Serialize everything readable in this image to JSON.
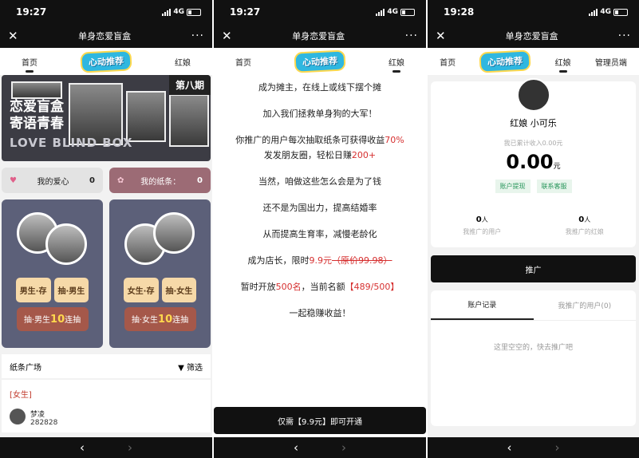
{
  "status": {
    "time1": "19:27",
    "time2": "19:27",
    "time3": "19:28",
    "network": "4G"
  },
  "app_title": "单身恋爱盲盒",
  "nav": {
    "home": "首页",
    "matchmaker": "红娘",
    "admin": "管理员端",
    "logo": "心动推荐"
  },
  "page1": {
    "banner_line1": "恋爱盲盒",
    "banner_line2": "寄语青春",
    "banner_en": "LOVE BLIND BOX",
    "issue": "第八期",
    "love_label": "我的爱心",
    "love_count": "0",
    "note_label": "我的纸条：",
    "note_count": "0",
    "male_store": "男生·存",
    "male_draw": "抽·男生",
    "male_big_pre": "抽·男生",
    "male_big_num": "10",
    "male_big_post": "连抽",
    "female_store": "女生·存",
    "female_draw": "抽·女生",
    "female_big_pre": "抽·女生",
    "female_big_num": "10",
    "female_big_post": "连抽",
    "square": "纸条广场",
    "filter": "▼ 筛选",
    "tag": "[女生]",
    "user_name": "梦凌",
    "user_id": "282828"
  },
  "page2": {
    "l1": "成为摊主，在线上或线下摆个摊",
    "l2": "加入我们拯救单身狗的大军！",
    "l3a": "你推广的用户每次抽取纸条可获得收益",
    "l3b": "70%",
    "l4a": "发发朋友圈，轻松日赚",
    "l4b": "200+",
    "l5": "当然，咱做这些怎么会是为了钱",
    "l6": "还不是为国出力，提高结婚率",
    "l7": "从而提高生育率，减慢老龄化",
    "l8a": "成为店长，限时",
    "l8b": "9.9元",
    "l8c": "（原价99.98）",
    "l9a": "暂时开放",
    "l9b": "500名",
    "l9c": "，当前名额",
    "l9d": "【489/500】",
    "l10": "一起稳赚收益！",
    "button": "仅需【9.9元】即可开通"
  },
  "page3": {
    "name": "红娘 小可乐",
    "earn_label": "我已累计收入0.00元",
    "amount": "0.00",
    "unit": "元",
    "withdraw": "账户提现",
    "support": "联系客服",
    "users_n": "0",
    "users_unit": "人",
    "users_label": "我推广的用户",
    "mm_n": "0",
    "mm_unit": "人",
    "mm_label": "我推广的红娘",
    "promote": "推广",
    "tab_records": "账户记录",
    "tab_users": "我推广的用户(0)",
    "empty": "这里空空的，快去推广吧"
  },
  "icons": {
    "close": "close-icon",
    "more": "more-icon",
    "back": "back-icon",
    "forward": "forward-icon",
    "filter": "filter-icon",
    "heart": "heart-icon"
  }
}
